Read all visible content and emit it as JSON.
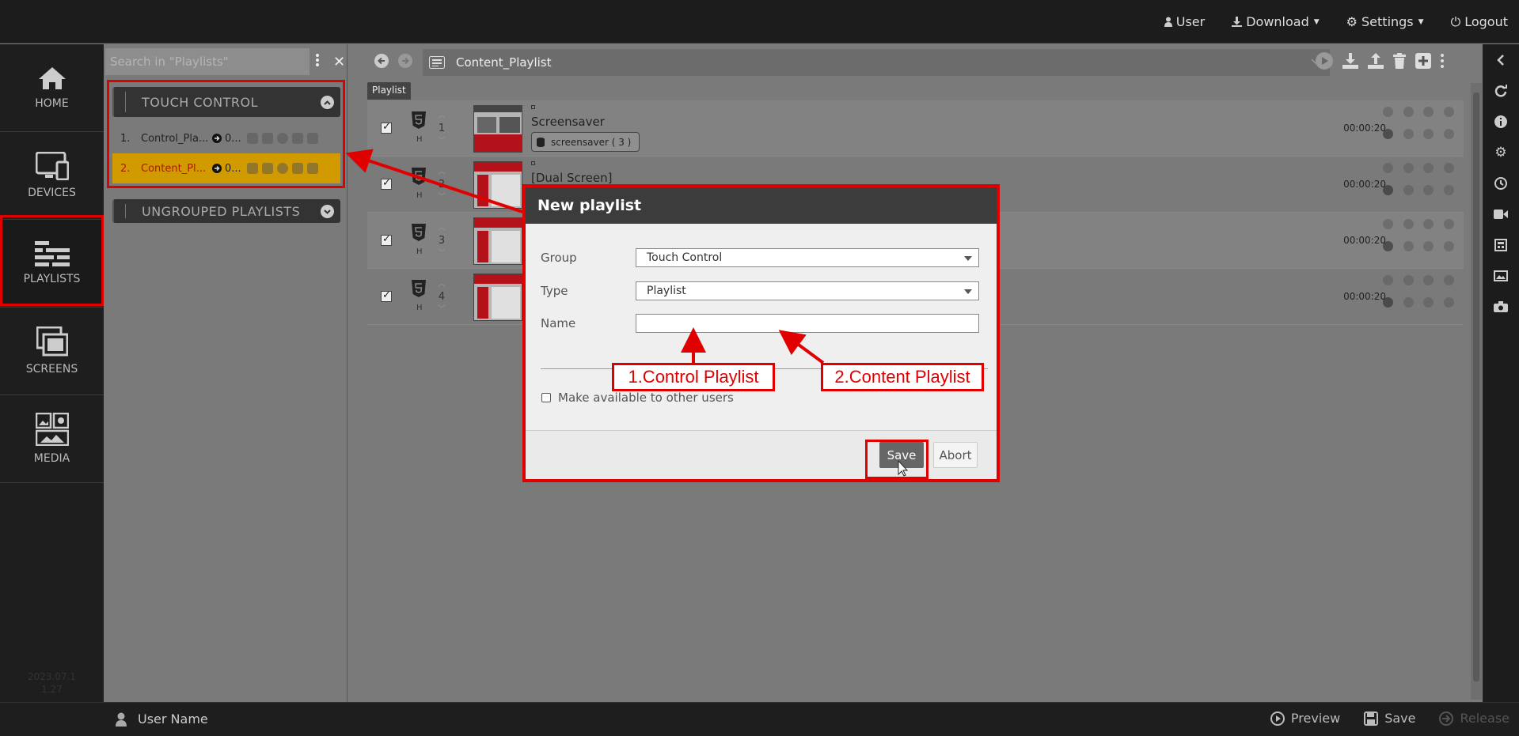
{
  "topbar": {
    "user": "User",
    "download": "Download",
    "settings": "Settings",
    "logout": "Logout"
  },
  "leftnav": {
    "items": [
      {
        "label": "HOME",
        "icon": "home-icon"
      },
      {
        "label": "DEVICES",
        "icon": "devices-icon"
      },
      {
        "label": "PLAYLISTS",
        "icon": "playlists-icon"
      },
      {
        "label": "SCREENS",
        "icon": "screens-icon"
      },
      {
        "label": "MEDIA",
        "icon": "media-icon"
      }
    ],
    "version_line1": "2023.07.1",
    "version_line2": "1.27"
  },
  "playlists_panel": {
    "search_placeholder": "Search in \"Playlists\"",
    "groups": [
      {
        "title": "TOUCH CONTROL",
        "expanded": true
      },
      {
        "title": "UNGROUPED PLAYLISTS",
        "expanded": false
      }
    ],
    "rows": [
      {
        "num": "1.",
        "name": "Control_Pla...",
        "duration": "0..."
      },
      {
        "num": "2.",
        "name": "Content_Pl...",
        "duration": "0...",
        "selected": true
      }
    ],
    "selected_color": "#d19b00"
  },
  "main": {
    "current_playlist": "Content_Playlist",
    "tab_label": "Playlist",
    "items": [
      {
        "index": "1",
        "name": "Screensaver",
        "tag": "screensaver ( 3 )",
        "time": "00:00:20",
        "format": "H"
      },
      {
        "index": "2",
        "name": "[Dual Screen]",
        "tag": "",
        "time": "00:00:20",
        "format": "H"
      },
      {
        "index": "3",
        "name": "",
        "tag": "",
        "time": "00:00:20",
        "format": "H"
      },
      {
        "index": "4",
        "name": "",
        "tag": "",
        "time": "00:00:20",
        "format": "H"
      }
    ]
  },
  "bottombar": {
    "user_name": "User Name",
    "preview": "Preview",
    "save": "Save",
    "release": "Release"
  },
  "modal": {
    "title": "New playlist",
    "group_label": "Group",
    "group_value": "Touch Control",
    "type_label": "Type",
    "type_value": "Playlist",
    "name_label": "Name",
    "name_value": "",
    "share_label": "Make available to other users",
    "save": "Save",
    "abort": "Abort"
  },
  "annotations": {
    "callout1": "1.Control Playlist",
    "callout2": "2.Content Playlist",
    "color": "#e00000"
  }
}
